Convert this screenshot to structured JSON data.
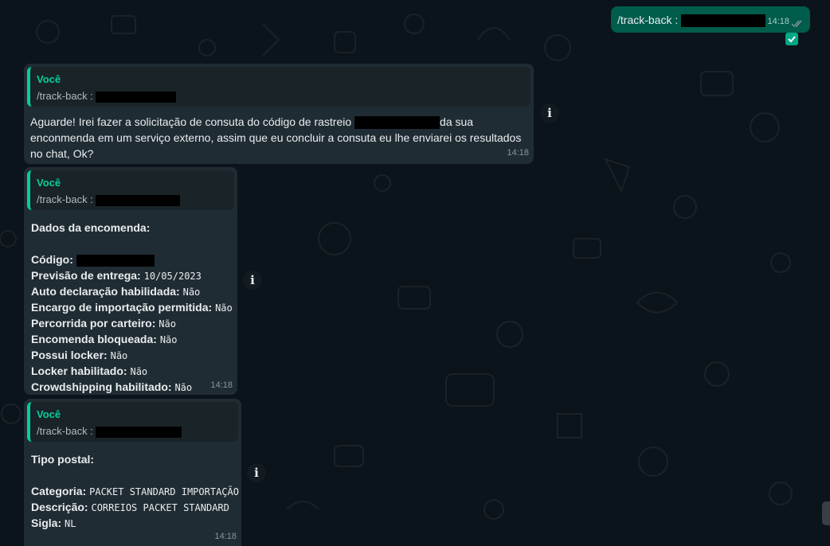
{
  "outgoing": {
    "text": "/track-back :",
    "time": "14:18",
    "status_icon": "double-check-icon"
  },
  "messages": [
    {
      "quote_author": "Você",
      "quote_text": "/track-back :",
      "body": "Aguarde! Irei fazer a solicitação de consuta do código de rastreio",
      "body_after": "da sua",
      "body_line2": "enconmenda em um serviço externo, assim que eu concluir a consuta eu lhe enviarei os resultados",
      "body_line3": "no chat, Ok?",
      "time": "14:18"
    },
    {
      "quote_author": "Você",
      "quote_text": "/track-back :",
      "heading": "Dados da encomenda:",
      "fields": [
        {
          "label": "Código:",
          "value": ""
        },
        {
          "label": "Previsão de entrega:",
          "value": "10/05/2023"
        },
        {
          "label": "Auto declaração habilidada:",
          "value": "Não"
        },
        {
          "label": "Encargo de importação permitida:",
          "value": "Não"
        },
        {
          "label": "Percorrida por carteiro:",
          "value": "Não"
        },
        {
          "label": "Encomenda bloqueada:",
          "value": "Não"
        },
        {
          "label": "Possui locker:",
          "value": "Não"
        },
        {
          "label": "Locker habilitado:",
          "value": "Não"
        },
        {
          "label": "Crowdshipping habilitado:",
          "value": "Não"
        }
      ],
      "time": "14:18"
    },
    {
      "quote_author": "Você",
      "quote_text": "/track-back :",
      "heading": "Tipo postal:",
      "fields": [
        {
          "label": "Categoria:",
          "value": "PACKET STANDARD IMPORTAÇÃO"
        },
        {
          "label": "Descrição:",
          "value": "CORREIOS PACKET STANDARD"
        },
        {
          "label": "Sigla:",
          "value": "NL"
        }
      ],
      "time": "14:18"
    }
  ],
  "icons": {
    "info": "info-icon",
    "select": "checkbox-checked-icon"
  },
  "colors": {
    "background": "#0b141a",
    "incoming": "#202c33",
    "outgoing": "#005c4b",
    "accent": "#06cf9c"
  }
}
